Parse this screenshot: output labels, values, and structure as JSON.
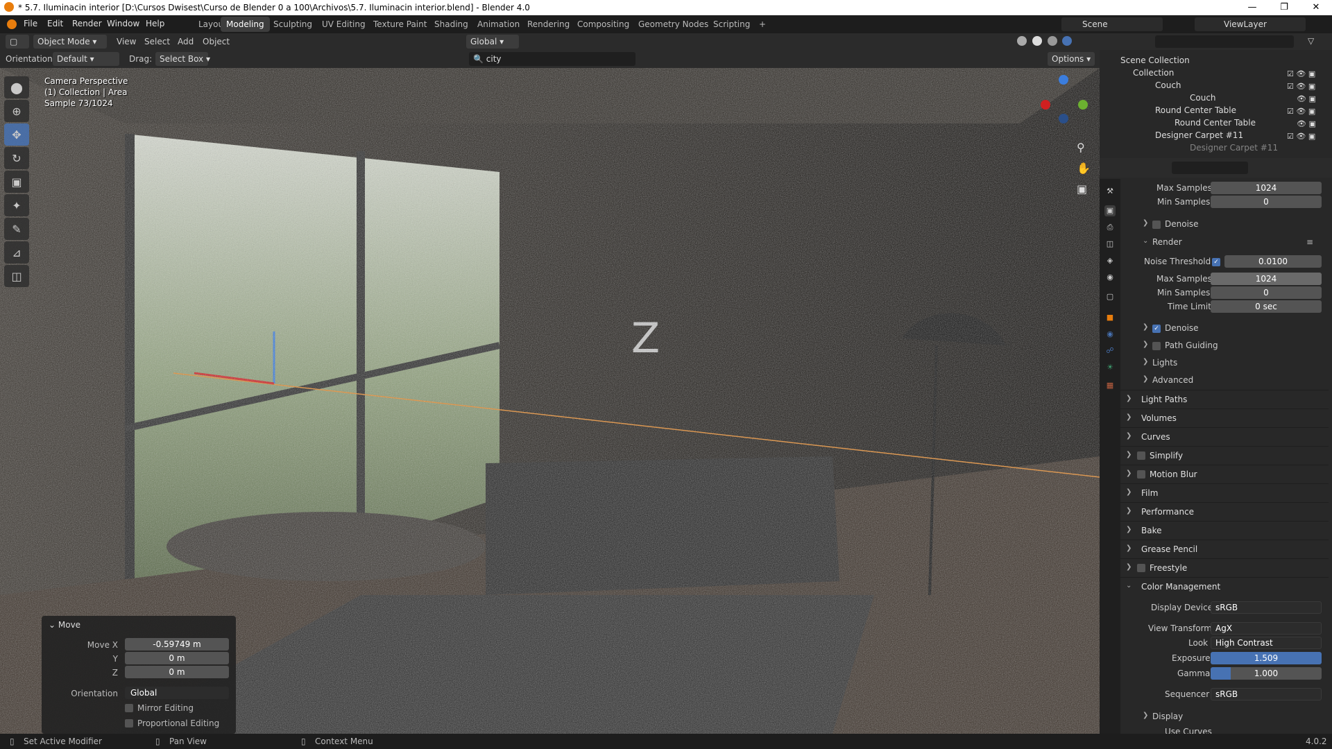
{
  "window": {
    "title": "* 5.7. Iluminacin interior [D:\\Cursos Dwisest\\Curso de Blender   0 a 100\\Archivos\\5.7. Iluminacin interior.blend] - Blender 4.0"
  },
  "menu": [
    "File",
    "Edit",
    "Render",
    "Window",
    "Help"
  ],
  "workspaces": [
    "Layout",
    "Modeling",
    "Sculpting",
    "UV Editing",
    "Texture Paint",
    "Shading",
    "Animation",
    "Rendering",
    "Compositing",
    "Geometry Nodes",
    "Scripting",
    "+"
  ],
  "active_workspace": "Modeling",
  "scene": {
    "scene_label": "Scene",
    "viewlayer_label": "ViewLayer"
  },
  "header": {
    "mode": "Object Mode",
    "view": "View",
    "select": "Select",
    "add": "Add",
    "object": "Object",
    "transform": "Global"
  },
  "header2": {
    "orientation_label": "Orientation:",
    "orientation_value": "Default",
    "drag_label": "Drag:",
    "drag_value": "Select Box",
    "search_value": "city",
    "options": "Options"
  },
  "viewport_info": {
    "line1": "Camera Perspective",
    "line2": "(1) Collection | Area",
    "line3": "Sample 73/1024"
  },
  "move_panel": {
    "title": "Move",
    "rows": [
      {
        "label": "Move X",
        "value": "-0.59749 m"
      },
      {
        "label": "Y",
        "value": "0 m"
      },
      {
        "label": "Z",
        "value": "0 m"
      }
    ],
    "orientation_label": "Orientation",
    "orientation_value": "Global",
    "mirror": "Mirror Editing",
    "proportional": "Proportional Editing"
  },
  "outliner": {
    "root": "Scene Collection",
    "items": [
      {
        "label": "Collection",
        "indent": 0
      },
      {
        "label": "Couch",
        "indent": 1
      },
      {
        "label": "Couch",
        "indent": 2
      },
      {
        "label": "Round Center Table",
        "indent": 1
      },
      {
        "label": "Round Center Table",
        "indent": 2
      },
      {
        "label": "Designer Carpet #11",
        "indent": 1
      },
      {
        "label": "Designer Carpet #11",
        "indent": 2
      }
    ]
  },
  "props": {
    "viewport_max_samples": {
      "label": "Max Samples",
      "value": "1024"
    },
    "viewport_min_samples": {
      "label": "Min Samples",
      "value": "0"
    },
    "denoise_viewport": "Denoise",
    "render_section": "Render",
    "noise_threshold": {
      "label": "Noise Threshold",
      "value": "0.0100"
    },
    "render_max_samples": {
      "label": "Max Samples",
      "value": "1024"
    },
    "render_min_samples": {
      "label": "Min Samples",
      "value": "0"
    },
    "time_limit": {
      "label": "Time Limit",
      "value": "0 sec"
    },
    "sub_sections": [
      "Denoise",
      "Path Guiding",
      "Lights",
      "Advanced"
    ],
    "sections": [
      "Light Paths",
      "Volumes",
      "Curves",
      "Simplify",
      "Motion Blur",
      "Film",
      "Performance",
      "Bake",
      "Grease Pencil",
      "Freestyle",
      "Color Management"
    ],
    "color_mgmt": {
      "display_device": {
        "label": "Display Device",
        "value": "sRGB"
      },
      "view_transform": {
        "label": "View Transform",
        "value": "AgX"
      },
      "look": {
        "label": "Look",
        "value": "High Contrast"
      },
      "exposure": {
        "label": "Exposure",
        "value": "1.509"
      },
      "gamma": {
        "label": "Gamma",
        "value": "1.000"
      },
      "sequencer": {
        "label": "Sequencer",
        "value": "sRGB"
      },
      "display": "Display",
      "use_curves": "Use Curves"
    }
  },
  "status": {
    "left": "Set Active Modifier",
    "mid": "Pan View",
    "right": "Context Menu",
    "version": "4.0.2"
  },
  "colors": {
    "accent": "#4772b3",
    "orange": "#e87d0d"
  }
}
